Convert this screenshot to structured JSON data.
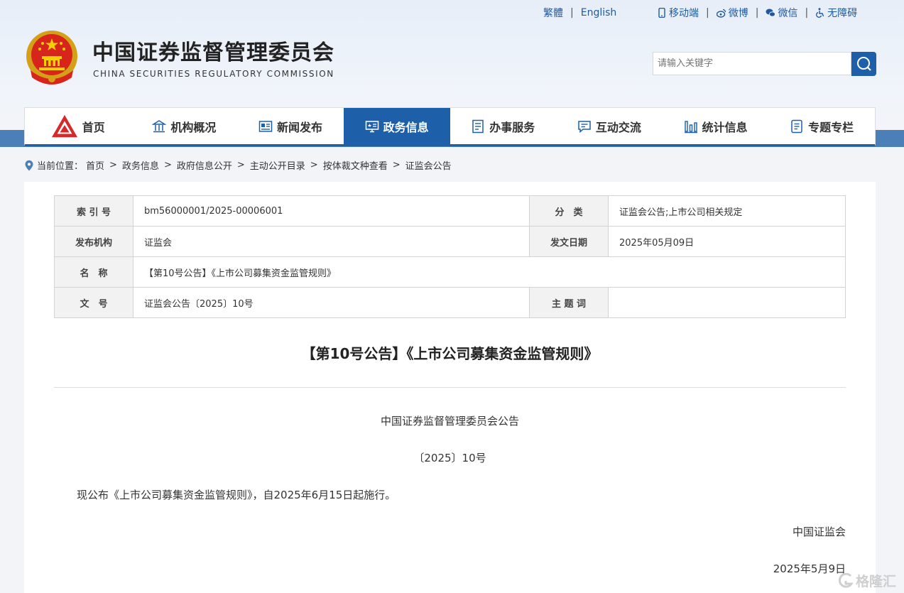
{
  "topbar": {
    "lang_traditional": "繁體",
    "lang_english": "English",
    "mobile": "移动端",
    "weibo": "微博",
    "wechat": "微信",
    "accessibility": "无障碍"
  },
  "header": {
    "title_cn": "中国证券监督管理委员会",
    "title_en": "CHINA SECURITIES REGULATORY COMMISSION",
    "search_placeholder": "请输入关键字"
  },
  "nav": {
    "items": [
      {
        "label": "首页",
        "icon": "home-logo-icon"
      },
      {
        "label": "机构概况",
        "icon": "institution-icon"
      },
      {
        "label": "新闻发布",
        "icon": "news-icon"
      },
      {
        "label": "政务信息",
        "icon": "gov-info-icon",
        "active": true
      },
      {
        "label": "办事服务",
        "icon": "service-icon"
      },
      {
        "label": "互动交流",
        "icon": "chat-icon"
      },
      {
        "label": "统计信息",
        "icon": "chart-icon"
      },
      {
        "label": "专题专栏",
        "icon": "topic-icon"
      }
    ],
    "active_color": "#1d5fa8"
  },
  "breadcrumb": {
    "prefix": "当前位置：",
    "items": [
      "首页",
      "政务信息",
      "政府信息公开",
      "主动公开目录",
      "按体裁文种查看",
      "证监会公告"
    ]
  },
  "meta": {
    "index_label": "索 引 号",
    "index_value": "bm56000001/2025-00006001",
    "category_label": "分　类",
    "category_value": "证监会公告;上市公司相关规定",
    "issuer_label": "发布机构",
    "issuer_value": "证监会",
    "date_label": "发文日期",
    "date_value": "2025年05月09日",
    "name_label": "名　称",
    "name_value": "【第10号公告】《上市公司募集资金监管规则》",
    "docno_label": "文　号",
    "docno_value": "证监会公告〔2025〕10号",
    "keyword_label": "主 题 词",
    "keyword_value": ""
  },
  "document": {
    "title": "【第10号公告】《上市公司募集资金监管规则》",
    "heading": "中国证券监督管理委员会公告",
    "number": "〔2025〕10号",
    "body": "现公布《上市公司募集资金监管规则》，自2025年6月15日起施行。",
    "signer": "中国证监会",
    "date": "2025年5月9日"
  },
  "watermark": "格隆汇"
}
